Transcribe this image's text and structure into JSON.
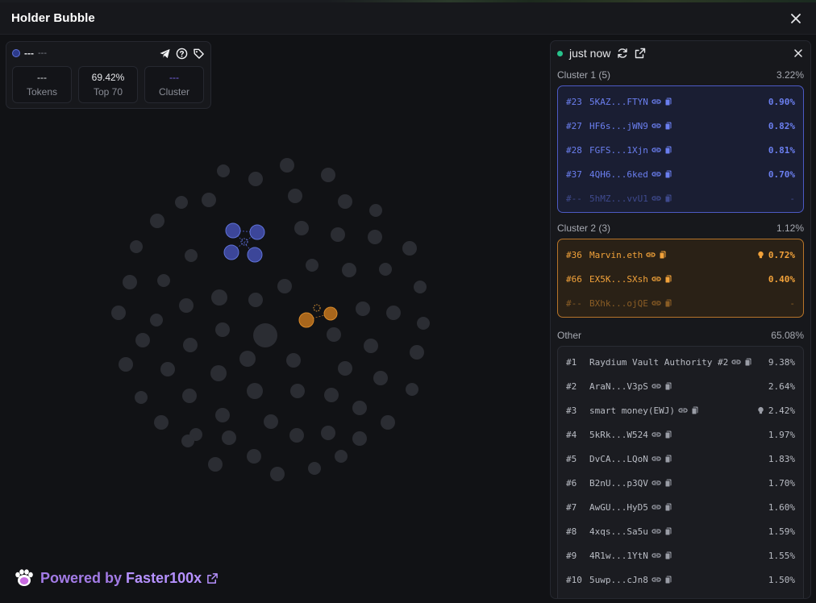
{
  "header": {
    "title": "Holder Bubble"
  },
  "stats": {
    "token_name": "---",
    "token_symbol": "---",
    "tokens_value": "---",
    "tokens_label": "Tokens",
    "top_value": "69.42%",
    "top_label": "Top 70",
    "cluster_value": "---",
    "cluster_label": "Cluster"
  },
  "panel": {
    "time": "just now",
    "clusters": [
      {
        "name": "Cluster 1 (5)",
        "percent": "3.22%",
        "color": "#6b7ff0",
        "rows": [
          {
            "rank": "#23",
            "addr": "5KAZ...FTYN",
            "pct": "0.90%"
          },
          {
            "rank": "#27",
            "addr": "HF6s...jWN9",
            "pct": "0.82%"
          },
          {
            "rank": "#28",
            "addr": "FGFS...1Xjn",
            "pct": "0.81%"
          },
          {
            "rank": "#37",
            "addr": "4QH6...6ked",
            "pct": "0.70%"
          },
          {
            "rank": "#--",
            "addr": "5hMZ...vvU1",
            "pct": "-"
          }
        ]
      },
      {
        "name": "Cluster 2 (3)",
        "percent": "1.12%",
        "color": "#f2a23a",
        "rows": [
          {
            "rank": "#36",
            "addr": "Marvin.eth",
            "pct": "0.72%"
          },
          {
            "rank": "#66",
            "addr": "EX5K...SXsh",
            "pct": "0.40%"
          },
          {
            "rank": "#--",
            "addr": "BXhk...ojQE",
            "pct": "-"
          }
        ]
      }
    ],
    "other": {
      "name": "Other",
      "percent": "65.08%",
      "rows": [
        {
          "rank": "#1",
          "addr": "Raydium Vault Authority #2",
          "pct": "9.38%"
        },
        {
          "rank": "#2",
          "addr": "AraN...V3pS",
          "pct": "2.64%"
        },
        {
          "rank": "#3",
          "addr": "smart money(EWJ)",
          "pct": "2.42%"
        },
        {
          "rank": "#4",
          "addr": "5kRk...W524",
          "pct": "1.97%"
        },
        {
          "rank": "#5",
          "addr": "DvCA...LQoN",
          "pct": "1.83%"
        },
        {
          "rank": "#6",
          "addr": "B2nU...p3QV",
          "pct": "1.70%"
        },
        {
          "rank": "#7",
          "addr": "AwGU...HyD5",
          "pct": "1.60%"
        },
        {
          "rank": "#8",
          "addr": "4xqs...Sa5u",
          "pct": "1.59%"
        },
        {
          "rank": "#9",
          "addr": "4R1w...1YtN",
          "pct": "1.55%"
        },
        {
          "rank": "#10",
          "addr": "5uwp...cJn8",
          "pct": "1.50%"
        }
      ]
    }
  },
  "powered": {
    "prefix": "Powered by",
    "brand": "Faster100x"
  }
}
